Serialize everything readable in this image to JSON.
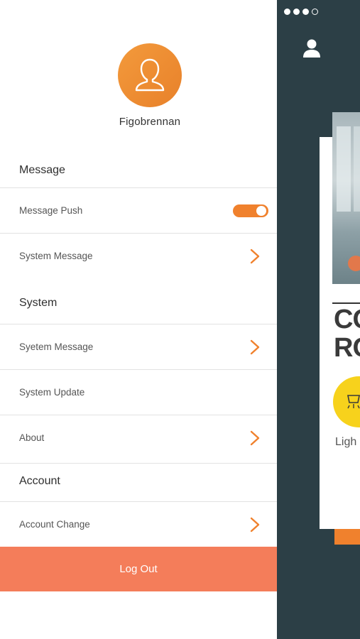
{
  "profile": {
    "username": "Figobrennan",
    "avatar_icon": "user-icon"
  },
  "sections": [
    {
      "title": "Message",
      "items": [
        {
          "label": "Message Push",
          "control": "toggle",
          "on": true
        },
        {
          "label": "System Message",
          "control": "chevron"
        }
      ]
    },
    {
      "title": "System",
      "items": [
        {
          "label": "Syetem Message",
          "control": "chevron"
        },
        {
          "label": "System Update",
          "control": "none"
        },
        {
          "label": "About",
          "control": "chevron"
        }
      ]
    },
    {
      "title": "Account",
      "items": [
        {
          "label": "Account Change",
          "control": "chevron"
        }
      ]
    }
  ],
  "logout_label": "Log Out",
  "background": {
    "page_dots": 4,
    "room_title_line1": "CO",
    "room_title_line2": "RO",
    "light_label": "Ligh"
  },
  "colors": {
    "accent": "#f0812d",
    "logout": "#f47d5a",
    "avatar": "#ea8530",
    "bg_dark": "#2c3f46",
    "light_yellow": "#f7d21c"
  }
}
